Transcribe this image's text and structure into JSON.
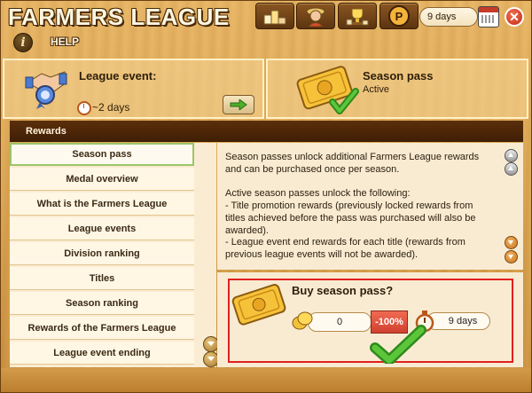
{
  "app": {
    "title": "FARMERS LEAGUE"
  },
  "toolbar": {
    "days_label": "9 days",
    "buttons": [
      "podium-icon",
      "farmer-icon",
      "trophy-icon",
      "season-pass-icon"
    ]
  },
  "help": {
    "label": "HELP"
  },
  "league_event": {
    "title": "League event:",
    "time_left": "~2 days"
  },
  "season_pass": {
    "title": "Season pass",
    "status": "Active"
  },
  "rewards_header": {
    "title": "Rewards"
  },
  "nav": {
    "items": [
      {
        "label": "Season pass",
        "active": true
      },
      {
        "label": "Medal overview"
      },
      {
        "label": "What is the Farmers League"
      },
      {
        "label": "League events"
      },
      {
        "label": "Division ranking"
      },
      {
        "label": "Titles"
      },
      {
        "label": "Season ranking"
      },
      {
        "label": "Rewards of the Farmers League"
      },
      {
        "label": "League event ending"
      }
    ]
  },
  "content": {
    "paragraph1": "Season passes unlock additional Farmers League rewards and can be purchased once per season.",
    "paragraph2": "Active season passes unlock the following:",
    "bullet1": "- Title promotion rewards (previously locked rewards from titles achieved before the pass was purchased will also be awarded).",
    "bullet2": "- League event end rewards for each title (rewards from previous league events will not be awarded)."
  },
  "buy": {
    "title": "Buy season pass?",
    "coins": "0",
    "discount": "-100%",
    "duration": "9 days"
  },
  "colors": {
    "accent_red": "#e02020",
    "header_brown": "#4a2608",
    "check_green": "#4fa82a"
  }
}
